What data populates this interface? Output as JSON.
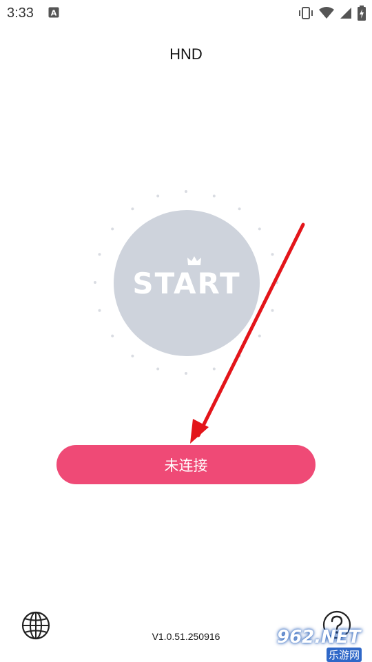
{
  "status_bar": {
    "time": "3:33",
    "notification_icon": "a-letter-icon",
    "icons": [
      "vibrate-icon",
      "wifi-icon",
      "cell-signal-icon",
      "battery-charging-icon"
    ]
  },
  "header": {
    "title": "HND"
  },
  "start": {
    "label": "START"
  },
  "connect_button": {
    "label": "未连接"
  },
  "footer": {
    "version": "V1.0.51.250916",
    "language_icon": "globe-icon",
    "help_icon": "help-icon"
  },
  "watermark": {
    "main": "962.NET",
    "sub": "乐游网"
  },
  "colors": {
    "accent": "#ef4a76",
    "start_circle": "#ced3dc",
    "annotation_arrow": "#e3151a"
  }
}
